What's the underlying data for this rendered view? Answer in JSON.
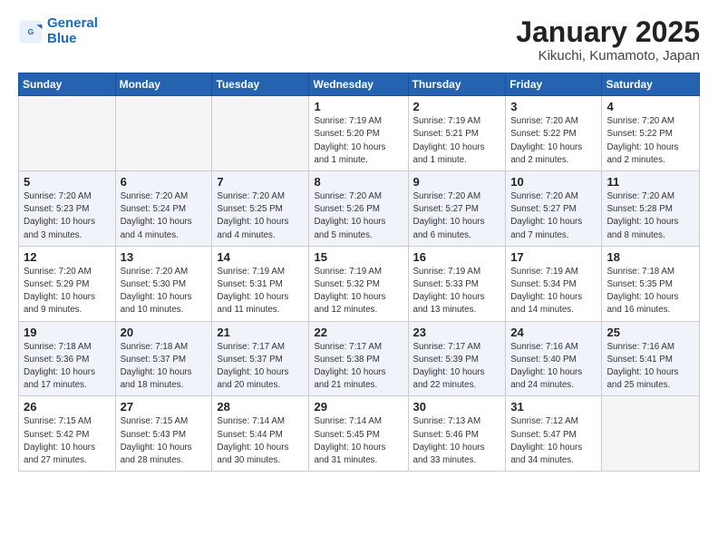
{
  "logo": {
    "line1": "General",
    "line2": "Blue"
  },
  "title": "January 2025",
  "location": "Kikuchi, Kumamoto, Japan",
  "weekdays": [
    "Sunday",
    "Monday",
    "Tuesday",
    "Wednesday",
    "Thursday",
    "Friday",
    "Saturday"
  ],
  "weeks": [
    [
      {
        "day": "",
        "info": ""
      },
      {
        "day": "",
        "info": ""
      },
      {
        "day": "",
        "info": ""
      },
      {
        "day": "1",
        "info": "Sunrise: 7:19 AM\nSunset: 5:20 PM\nDaylight: 10 hours\nand 1 minute."
      },
      {
        "day": "2",
        "info": "Sunrise: 7:19 AM\nSunset: 5:21 PM\nDaylight: 10 hours\nand 1 minute."
      },
      {
        "day": "3",
        "info": "Sunrise: 7:20 AM\nSunset: 5:22 PM\nDaylight: 10 hours\nand 2 minutes."
      },
      {
        "day": "4",
        "info": "Sunrise: 7:20 AM\nSunset: 5:22 PM\nDaylight: 10 hours\nand 2 minutes."
      }
    ],
    [
      {
        "day": "5",
        "info": "Sunrise: 7:20 AM\nSunset: 5:23 PM\nDaylight: 10 hours\nand 3 minutes."
      },
      {
        "day": "6",
        "info": "Sunrise: 7:20 AM\nSunset: 5:24 PM\nDaylight: 10 hours\nand 4 minutes."
      },
      {
        "day": "7",
        "info": "Sunrise: 7:20 AM\nSunset: 5:25 PM\nDaylight: 10 hours\nand 4 minutes."
      },
      {
        "day": "8",
        "info": "Sunrise: 7:20 AM\nSunset: 5:26 PM\nDaylight: 10 hours\nand 5 minutes."
      },
      {
        "day": "9",
        "info": "Sunrise: 7:20 AM\nSunset: 5:27 PM\nDaylight: 10 hours\nand 6 minutes."
      },
      {
        "day": "10",
        "info": "Sunrise: 7:20 AM\nSunset: 5:27 PM\nDaylight: 10 hours\nand 7 minutes."
      },
      {
        "day": "11",
        "info": "Sunrise: 7:20 AM\nSunset: 5:28 PM\nDaylight: 10 hours\nand 8 minutes."
      }
    ],
    [
      {
        "day": "12",
        "info": "Sunrise: 7:20 AM\nSunset: 5:29 PM\nDaylight: 10 hours\nand 9 minutes."
      },
      {
        "day": "13",
        "info": "Sunrise: 7:20 AM\nSunset: 5:30 PM\nDaylight: 10 hours\nand 10 minutes."
      },
      {
        "day": "14",
        "info": "Sunrise: 7:19 AM\nSunset: 5:31 PM\nDaylight: 10 hours\nand 11 minutes."
      },
      {
        "day": "15",
        "info": "Sunrise: 7:19 AM\nSunset: 5:32 PM\nDaylight: 10 hours\nand 12 minutes."
      },
      {
        "day": "16",
        "info": "Sunrise: 7:19 AM\nSunset: 5:33 PM\nDaylight: 10 hours\nand 13 minutes."
      },
      {
        "day": "17",
        "info": "Sunrise: 7:19 AM\nSunset: 5:34 PM\nDaylight: 10 hours\nand 14 minutes."
      },
      {
        "day": "18",
        "info": "Sunrise: 7:18 AM\nSunset: 5:35 PM\nDaylight: 10 hours\nand 16 minutes."
      }
    ],
    [
      {
        "day": "19",
        "info": "Sunrise: 7:18 AM\nSunset: 5:36 PM\nDaylight: 10 hours\nand 17 minutes."
      },
      {
        "day": "20",
        "info": "Sunrise: 7:18 AM\nSunset: 5:37 PM\nDaylight: 10 hours\nand 18 minutes."
      },
      {
        "day": "21",
        "info": "Sunrise: 7:17 AM\nSunset: 5:37 PM\nDaylight: 10 hours\nand 20 minutes."
      },
      {
        "day": "22",
        "info": "Sunrise: 7:17 AM\nSunset: 5:38 PM\nDaylight: 10 hours\nand 21 minutes."
      },
      {
        "day": "23",
        "info": "Sunrise: 7:17 AM\nSunset: 5:39 PM\nDaylight: 10 hours\nand 22 minutes."
      },
      {
        "day": "24",
        "info": "Sunrise: 7:16 AM\nSunset: 5:40 PM\nDaylight: 10 hours\nand 24 minutes."
      },
      {
        "day": "25",
        "info": "Sunrise: 7:16 AM\nSunset: 5:41 PM\nDaylight: 10 hours\nand 25 minutes."
      }
    ],
    [
      {
        "day": "26",
        "info": "Sunrise: 7:15 AM\nSunset: 5:42 PM\nDaylight: 10 hours\nand 27 minutes."
      },
      {
        "day": "27",
        "info": "Sunrise: 7:15 AM\nSunset: 5:43 PM\nDaylight: 10 hours\nand 28 minutes."
      },
      {
        "day": "28",
        "info": "Sunrise: 7:14 AM\nSunset: 5:44 PM\nDaylight: 10 hours\nand 30 minutes."
      },
      {
        "day": "29",
        "info": "Sunrise: 7:14 AM\nSunset: 5:45 PM\nDaylight: 10 hours\nand 31 minutes."
      },
      {
        "day": "30",
        "info": "Sunrise: 7:13 AM\nSunset: 5:46 PM\nDaylight: 10 hours\nand 33 minutes."
      },
      {
        "day": "31",
        "info": "Sunrise: 7:12 AM\nSunset: 5:47 PM\nDaylight: 10 hours\nand 34 minutes."
      },
      {
        "day": "",
        "info": ""
      }
    ]
  ]
}
